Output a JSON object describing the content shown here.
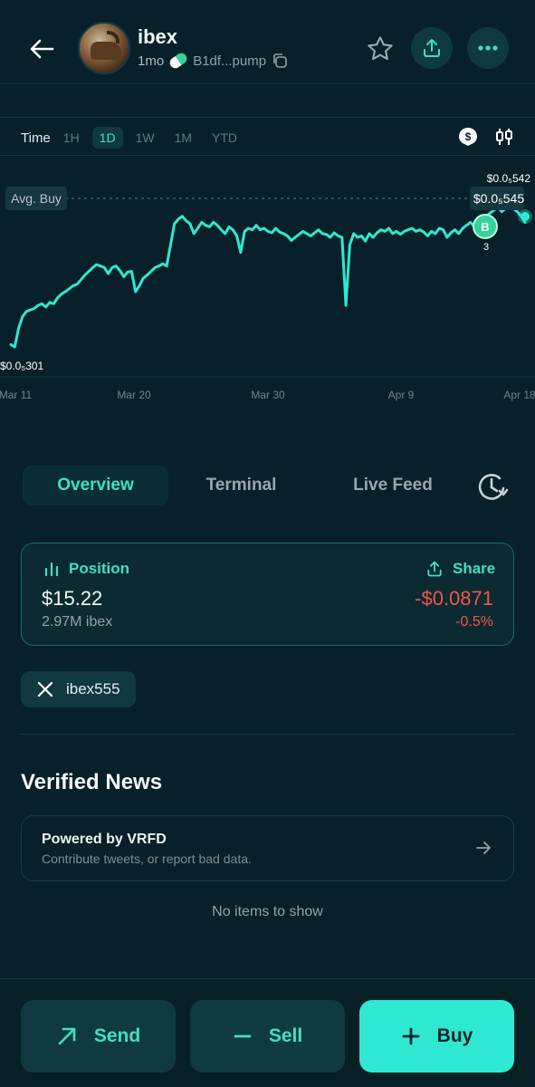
{
  "header": {
    "back_icon": "arrow-left-icon",
    "token_name": "ibex",
    "age": "1mo",
    "contract": "B1df...pump",
    "star_icon": "star-icon",
    "share_icon": "upload-icon",
    "more_icon": "more-dots-icon"
  },
  "timeframe": {
    "label": "Time",
    "options": [
      "1H",
      "1D",
      "1W",
      "1M",
      "YTD"
    ],
    "selected": "1D"
  },
  "chart_data": {
    "type": "line",
    "x_ticks": [
      "Mar 11",
      "Mar 20",
      "Mar 30",
      "Apr 9",
      "Apr 18"
    ],
    "high_label": "$0.0₅542",
    "low_label": "$0.0₅301",
    "current_label": "$0.0₅545",
    "avg_buy_label": "Avg. Buy",
    "buy_marker": {
      "letter": "B",
      "count": "3"
    },
    "series": [
      {
        "values": [
          3.08,
          3.05,
          3.3,
          3.45,
          3.52,
          3.54,
          3.56,
          3.6,
          3.62,
          3.58,
          3.64,
          3.62,
          3.7,
          3.75,
          3.78,
          3.82,
          3.86,
          3.88,
          3.94,
          4.0,
          4.05,
          4.1,
          4.14,
          4.12,
          4.1,
          4.02,
          4.1,
          4.12,
          4.06,
          3.98,
          4.04,
          4.05,
          3.78,
          3.86,
          3.96,
          4.0,
          4.05,
          4.1,
          4.12,
          4.15,
          4.12,
          4.4,
          4.68,
          4.74,
          4.78,
          4.72,
          4.68,
          4.55,
          4.62,
          4.7,
          4.66,
          4.64,
          4.7,
          4.66,
          4.6,
          4.55,
          4.64,
          4.6,
          4.52,
          4.3,
          4.58,
          4.62,
          4.6,
          4.66,
          4.6,
          4.62,
          4.58,
          4.56,
          4.62,
          4.57,
          4.55,
          4.52,
          4.46,
          4.5,
          4.54,
          4.58,
          4.55,
          4.52,
          4.56,
          4.6,
          4.55,
          4.54,
          4.5,
          4.56,
          4.52,
          4.5,
          3.6,
          4.4,
          4.55,
          4.5,
          4.52,
          4.45,
          4.55,
          4.5,
          4.56,
          4.6,
          4.58,
          4.62,
          4.55,
          4.58,
          4.54,
          4.58,
          4.6,
          4.62,
          4.58,
          4.6,
          4.57,
          4.52,
          4.58,
          4.55,
          4.62,
          4.6,
          4.5,
          4.56,
          4.6,
          4.55,
          4.62,
          4.66,
          4.7,
          4.64,
          4.72,
          4.7,
          4.78,
          4.82,
          4.86,
          4.9,
          4.84,
          4.88,
          4.92,
          4.88,
          4.84,
          4.78,
          4.7
        ]
      }
    ]
  },
  "tabs": [
    "Overview",
    "Terminal",
    "Live Feed"
  ],
  "active_tab": "Overview",
  "history_icon": "history-clock-icon",
  "position": {
    "title": "Position",
    "share_label": "Share",
    "value": "$15.22",
    "amount": "2.97M ibex",
    "pnl": "-$0.0871",
    "pnl_pct": "-0.5%"
  },
  "social": {
    "x_handle": "ibex555"
  },
  "news": {
    "title": "Verified News",
    "card_title": "Powered by VRFD",
    "card_subtitle": "Contribute tweets, or report bad data.",
    "empty": "No items to show"
  },
  "actions": {
    "send": "Send",
    "sell": "Sell",
    "buy": "Buy"
  },
  "colors": {
    "accent": "#3ee0c6",
    "negative": "#f0554f",
    "background": "#07202a"
  }
}
